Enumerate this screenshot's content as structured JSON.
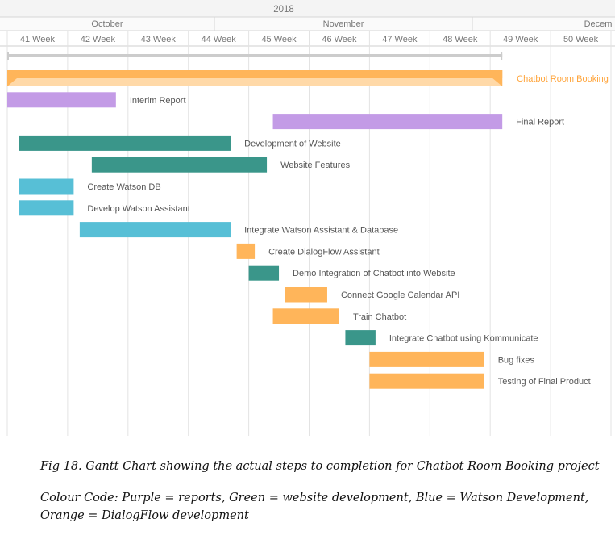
{
  "chart_data": {
    "type": "gantt",
    "year": "2018",
    "months": [
      "October",
      "November",
      "Decem"
    ],
    "weeks": [
      "41 Week",
      "42 Week",
      "43 Week",
      "44 Week",
      "45 Week",
      "46 Week",
      "47 Week",
      "48 Week",
      "49 Week",
      "50 Week"
    ],
    "summary": {
      "start_week": 41.0,
      "end_week": 49.2
    },
    "tasks": [
      {
        "name": "Chatbot Room Booking",
        "start_week": 41.0,
        "end_week": 49.2,
        "category": "project"
      },
      {
        "name": "Interim Report",
        "start_week": 41.0,
        "end_week": 42.8,
        "category": "report"
      },
      {
        "name": "Final Report",
        "start_week": 45.4,
        "end_week": 49.2,
        "category": "report"
      },
      {
        "name": "Development of Website",
        "start_week": 41.2,
        "end_week": 44.7,
        "category": "website"
      },
      {
        "name": "Website Features",
        "start_week": 42.4,
        "end_week": 45.3,
        "category": "website"
      },
      {
        "name": "Create Watson DB",
        "start_week": 41.2,
        "end_week": 42.1,
        "category": "watson"
      },
      {
        "name": "Develop Watson Assistant",
        "start_week": 41.2,
        "end_week": 42.1,
        "category": "watson"
      },
      {
        "name": "Integrate Watson Assistant & Database",
        "start_week": 42.2,
        "end_week": 44.7,
        "category": "watson"
      },
      {
        "name": "Create DialogFlow Assistant",
        "start_week": 44.8,
        "end_week": 45.1,
        "category": "dialogflow"
      },
      {
        "name": "Demo Integration of Chatbot into Website",
        "start_week": 45.0,
        "end_week": 45.5,
        "category": "website"
      },
      {
        "name": "Connect Google Calendar API",
        "start_week": 45.6,
        "end_week": 46.3,
        "category": "dialogflow"
      },
      {
        "name": "Train Chatbot",
        "start_week": 45.4,
        "end_week": 46.5,
        "category": "dialogflow"
      },
      {
        "name": "Integrate Chatbot using Kommunicate",
        "start_week": 46.6,
        "end_week": 47.1,
        "category": "website"
      },
      {
        "name": "Bug fixes",
        "start_week": 47.0,
        "end_week": 48.9,
        "category": "dialogflow"
      },
      {
        "name": "Testing of Final Product",
        "start_week": 47.0,
        "end_week": 48.9,
        "category": "dialogflow"
      }
    ],
    "colors": {
      "project": "#ffb55a",
      "report": "#c39be6",
      "website": "#3a968a",
      "watson": "#57bfd6",
      "dialogflow": "#ffb55a",
      "summary": "#cccccc",
      "grid": "#e3e3e3",
      "header_text": "#777777",
      "label_text": "#555555",
      "project_label": "#ffa43a"
    },
    "grid": true
  },
  "captions": {
    "figure": "Fig 18. Gantt Chart showing the actual steps to completion for Chatbot Room Booking project",
    "colour_code": "Colour Code: Purple = reports, Green = website development, Blue = Watson Development, Orange = DialogFlow development"
  }
}
